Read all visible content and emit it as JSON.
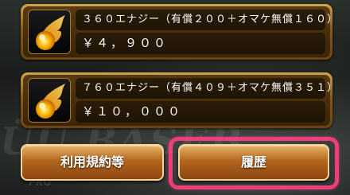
{
  "shop": {
    "items": [
      {
        "name": "３６０エナジー（有償２００＋オマケ無償１６０）",
        "price": "￥４，９００",
        "icon": "energy-fireball-icon"
      },
      {
        "name": "７６０エナジー（有償４０９＋オマケ無償３５１）",
        "price": "￥１０，０００",
        "icon": "energy-fireball-icon"
      }
    ],
    "buttons": {
      "terms_label": "利用規約等",
      "history_label": "履歴"
    }
  },
  "colors": {
    "highlight": "#ef3e7b",
    "button_gold": "#b3661f"
  }
}
